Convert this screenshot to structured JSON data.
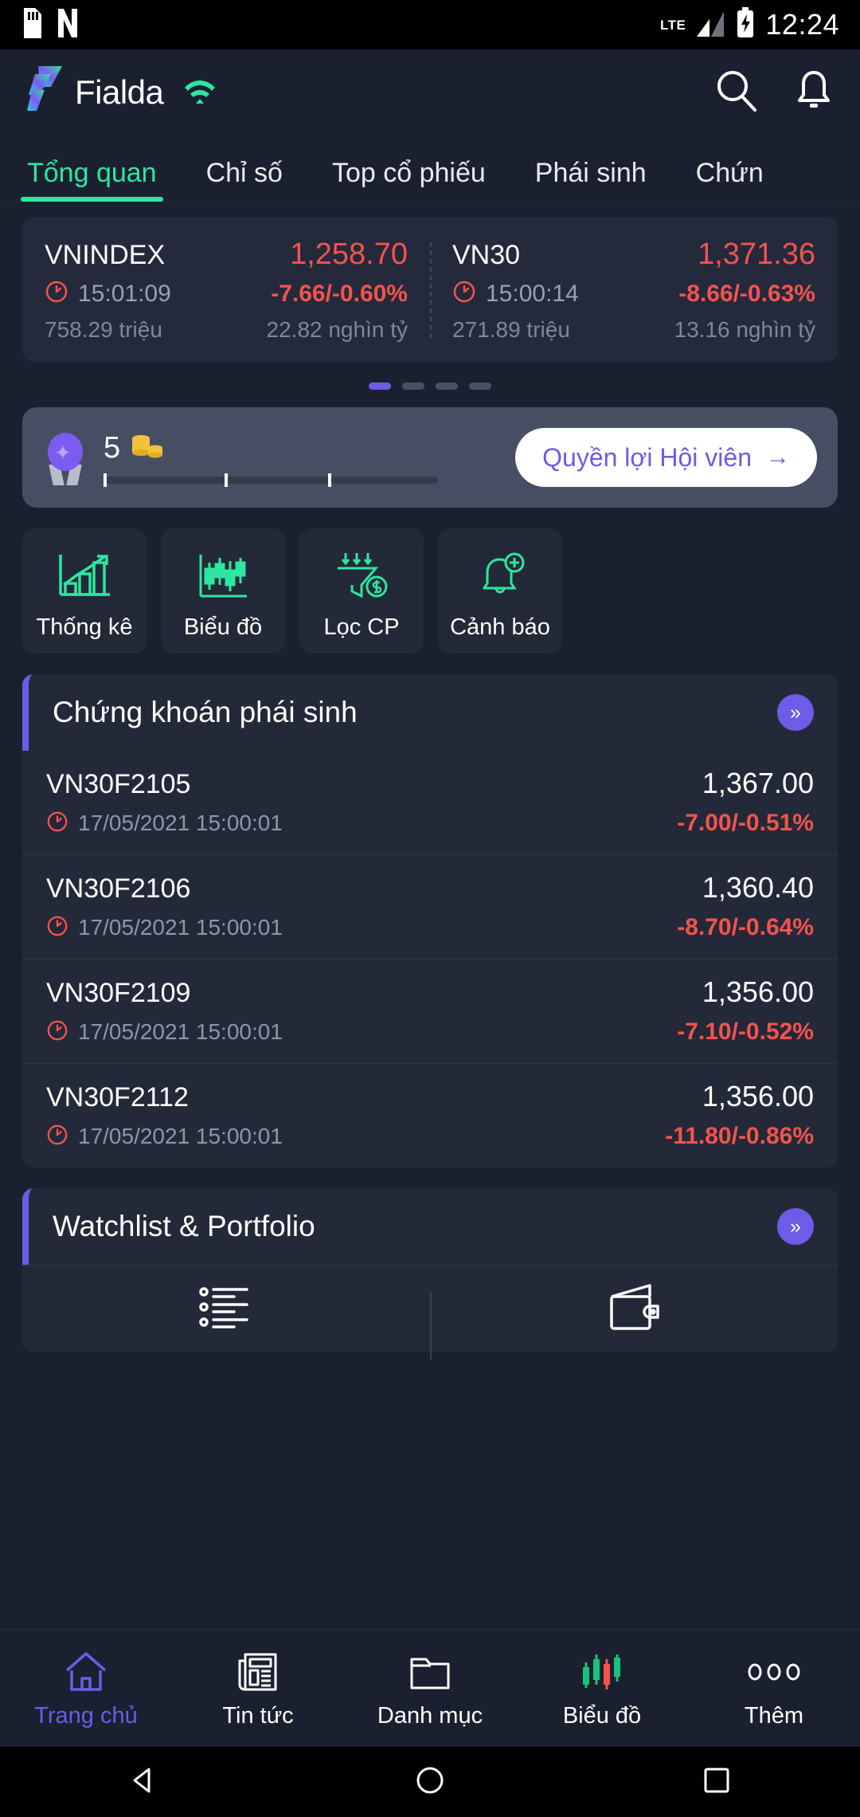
{
  "statusbar": {
    "sim_icon": "sim-card-icon",
    "nfc_icon": "nfc-icon",
    "network_label": "LTE",
    "signal_icon": "signal-bars-icon",
    "battery_icon": "battery-charging-icon",
    "time": "12:24"
  },
  "header": {
    "logo_text": "Fialda",
    "logo_mark_icon": "fialda-logo-icon",
    "wifi_icon": "wifi-icon",
    "search_icon": "search-icon",
    "bell_icon": "bell-icon"
  },
  "tabs": [
    {
      "label": "Tổng quan",
      "active": true
    },
    {
      "label": "Chỉ số",
      "active": false
    },
    {
      "label": "Top cổ phiếu",
      "active": false
    },
    {
      "label": "Phái sinh",
      "active": false
    },
    {
      "label": "Chứn",
      "active": false
    }
  ],
  "indices": [
    {
      "name": "VNINDEX",
      "price": "1,258.70",
      "time": "15:01:09",
      "change": "-7.66/-0.60%",
      "volume": "758.29 triệu",
      "value": "22.82 nghìn tỷ",
      "clock_icon": "clock-icon"
    },
    {
      "name": "VN30",
      "price": "1,371.36",
      "time": "15:00:14",
      "change": "-8.66/-0.63%",
      "volume": "271.89 triệu",
      "value": "13.16 nghìn tỷ",
      "clock_icon": "clock-icon"
    }
  ],
  "pager": {
    "count": 4,
    "active_index": 0
  },
  "member": {
    "medal_icon": "medal-icon",
    "count": "5",
    "coins_icon": "coin-stack-icon",
    "button_label": "Quyền lợi Hội viên",
    "button_arrow": "→",
    "progress_percent": 0
  },
  "quick_actions": [
    {
      "label": "Thống kê",
      "icon": "bar-chart-trend-icon"
    },
    {
      "label": "Biểu đồ",
      "icon": "candlestick-chart-icon"
    },
    {
      "label": "Lọc CP",
      "icon": "funnel-dollar-icon"
    },
    {
      "label": "Cảnh báo",
      "icon": "bell-plus-icon"
    }
  ],
  "derivatives": {
    "title": "Chứng khoán phái sinh",
    "more_icon": "chevron-double-right-icon",
    "rows": [
      {
        "symbol": "VN30F2105",
        "price": "1,367.00",
        "time": "17/05/2021 15:00:01",
        "change": "-7.00/-0.51%",
        "clock_icon": "clock-icon"
      },
      {
        "symbol": "VN30F2106",
        "price": "1,360.40",
        "time": "17/05/2021 15:00:01",
        "change": "-8.70/-0.64%",
        "clock_icon": "clock-icon"
      },
      {
        "symbol": "VN30F2109",
        "price": "1,356.00",
        "time": "17/05/2021 15:00:01",
        "change": "-7.10/-0.52%",
        "clock_icon": "clock-icon"
      },
      {
        "symbol": "VN30F2112",
        "price": "1,356.00",
        "time": "17/05/2021 15:00:01",
        "change": "-11.80/-0.86%",
        "clock_icon": "clock-icon"
      }
    ]
  },
  "watchlist": {
    "title": "Watchlist & Portfolio",
    "more_icon": "chevron-double-right-icon",
    "items": [
      {
        "icon": "bullet-list-icon"
      },
      {
        "icon": "wallet-icon"
      }
    ]
  },
  "bottom_nav": [
    {
      "label": "Trang chủ",
      "icon": "home-icon",
      "active": true
    },
    {
      "label": "Tin tức",
      "icon": "newspaper-icon",
      "active": false
    },
    {
      "label": "Danh mục",
      "icon": "folder-icon",
      "active": false
    },
    {
      "label": "Biểu đồ",
      "icon": "candlestick-icon",
      "active": false
    },
    {
      "label": "Thêm",
      "icon": "more-dots-icon",
      "active": false
    }
  ],
  "system_nav": [
    {
      "icon": "back-triangle-icon"
    },
    {
      "icon": "home-circle-icon"
    },
    {
      "icon": "recents-square-icon"
    }
  ],
  "colors": {
    "accent_green": "#2ee6a0",
    "accent_purple": "#6c5ce7",
    "down_red": "#f4534e",
    "bg": "#1b2030",
    "card": "#232938"
  }
}
